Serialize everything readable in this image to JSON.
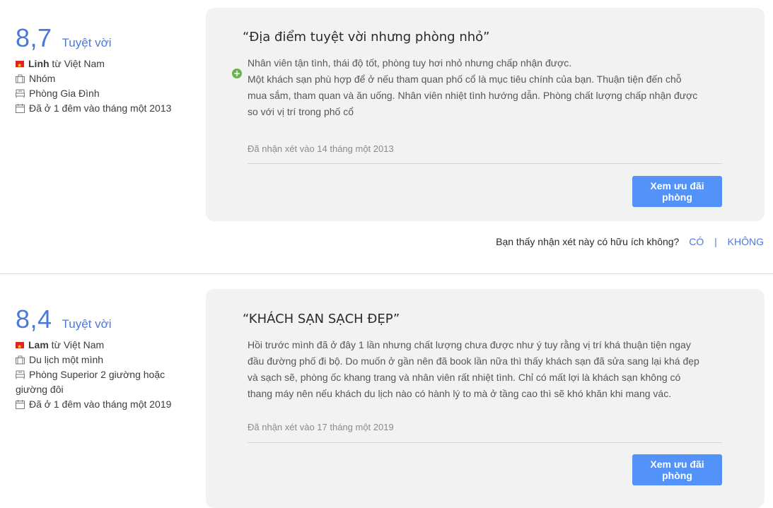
{
  "reviews": [
    {
      "score": "8,7",
      "score_text": "Tuyệt vời",
      "reviewer_name": "Linh",
      "reviewer_origin": " từ Việt Nam",
      "traveler_type": "Nhóm",
      "room_type": "Phòng Gia Đình",
      "stay": "Đã ở 1 đêm vào tháng một 2013",
      "title": "“Địa điểm tuyệt vời nhưng phòng nhỏ”",
      "body_lines": [
        "Nhân viên tận tình, thái độ tốt, phòng tuy hơi nhỏ nhưng chấp nhận được.",
        "Một khách sạn phù hợp để ở nếu tham quan phố cổ là mục tiêu chính của bạn. Thuận tiện đến chỗ",
        "mua sắm, tham quan và ăn uống. Nhân viên nhiệt tình hướng dẫn. Phòng chất lượng chấp nhận được",
        "so với vị trí trong phố cổ"
      ],
      "review_date": "Đã nhận xét vào 14 tháng một 2013",
      "button_label": "Xem ưu đãi phòng"
    },
    {
      "score": "8,4",
      "score_text": "Tuyệt vời",
      "reviewer_name": "Lam",
      "reviewer_origin": " từ Việt Nam",
      "traveler_type": "Du lịch một mình",
      "room_type_lines": [
        "Phòng Superior 2 giường hoặc",
        "giường đôi"
      ],
      "stay": "Đã ở 1 đêm vào tháng một 2019",
      "title": "“KHÁCH SẠN SẠCH ĐẸP”",
      "body_lines": [
        "Hồi trước mình đã ở đây 1 lần nhưng chất lượng chưa được như ý tuy rằng vị trí khá thuận tiện ngay",
        "đầu đường phố đi bộ. Do muốn ở gần nên đã book lần nữa thì thấy khách sạn đã sửa sang lại khá đẹp",
        "và sạch sẽ, phòng ốc khang trang và nhân viên rất nhiệt tình. Chỉ có mất lợi là khách sạn không có",
        "thang máy nên nếu khách du lịch nào có hành lý to mà ở tầng cao thì sẽ khó khăn khi mang vác."
      ],
      "review_date": "Đã nhận xét vào 17 tháng một 2019",
      "button_label": "Xem ưu đãi phòng"
    }
  ],
  "helpful": {
    "question": "Bạn thấy nhận xét này có hữu ích không?",
    "yes": "CÓ",
    "separator": "|",
    "no": "KHÔNG"
  },
  "icons": {
    "flag": "vietnam-flag-icon",
    "traveler": "briefcase-icon",
    "room": "bed-icon",
    "stay": "calendar-icon",
    "pros": "plus-circle-icon"
  },
  "colors": {
    "accent": "#4b79d8",
    "button": "#5392f9",
    "card": "#f2f2f3",
    "positive": "#6ab24a"
  }
}
